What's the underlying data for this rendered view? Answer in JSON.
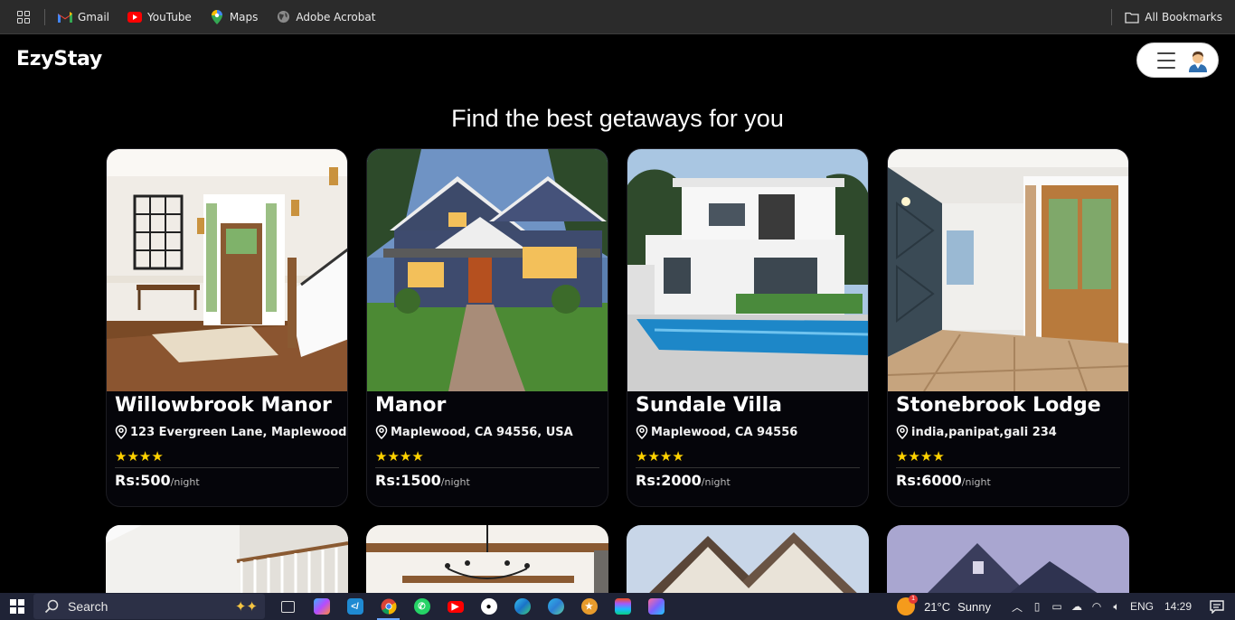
{
  "bookmarks": {
    "items": [
      {
        "label": "Gmail",
        "icon": "gmail-icon"
      },
      {
        "label": "YouTube",
        "icon": "youtube-icon"
      },
      {
        "label": "Maps",
        "icon": "maps-icon"
      },
      {
        "label": "Adobe Acrobat",
        "icon": "globe-icon"
      }
    ],
    "all_bookmarks": "All Bookmarks"
  },
  "nav": {
    "logo": "EzyStay"
  },
  "heading": "Find the best getaways for you",
  "listings": [
    {
      "title": "Willowbrook Manor",
      "location": "123 Evergreen Lane, Maplewood",
      "stars": "★★★★",
      "price": "Rs:500",
      "unit": "/night"
    },
    {
      "title": "Manor",
      "location": "Maplewood, CA 94556, USA",
      "stars": "★★★★",
      "price": "Rs:1500",
      "unit": "/night"
    },
    {
      "title": "Sundale Villa",
      "location": "Maplewood, CA 94556",
      "stars": "★★★★",
      "price": "Rs:2000",
      "unit": "/night"
    },
    {
      "title": "Stonebrook Lodge",
      "location": "india,panipat,gali 234",
      "stars": "★★★★",
      "price": "Rs:6000",
      "unit": "/night"
    }
  ],
  "taskbar": {
    "search": "Search",
    "weather": {
      "temp": "21°C",
      "condition": "Sunny",
      "badge": "1"
    },
    "language": "ENG",
    "time": "14:29"
  },
  "colors": {
    "background": "#000000",
    "star": "#ffd200",
    "taskbar": "#1f2336"
  }
}
